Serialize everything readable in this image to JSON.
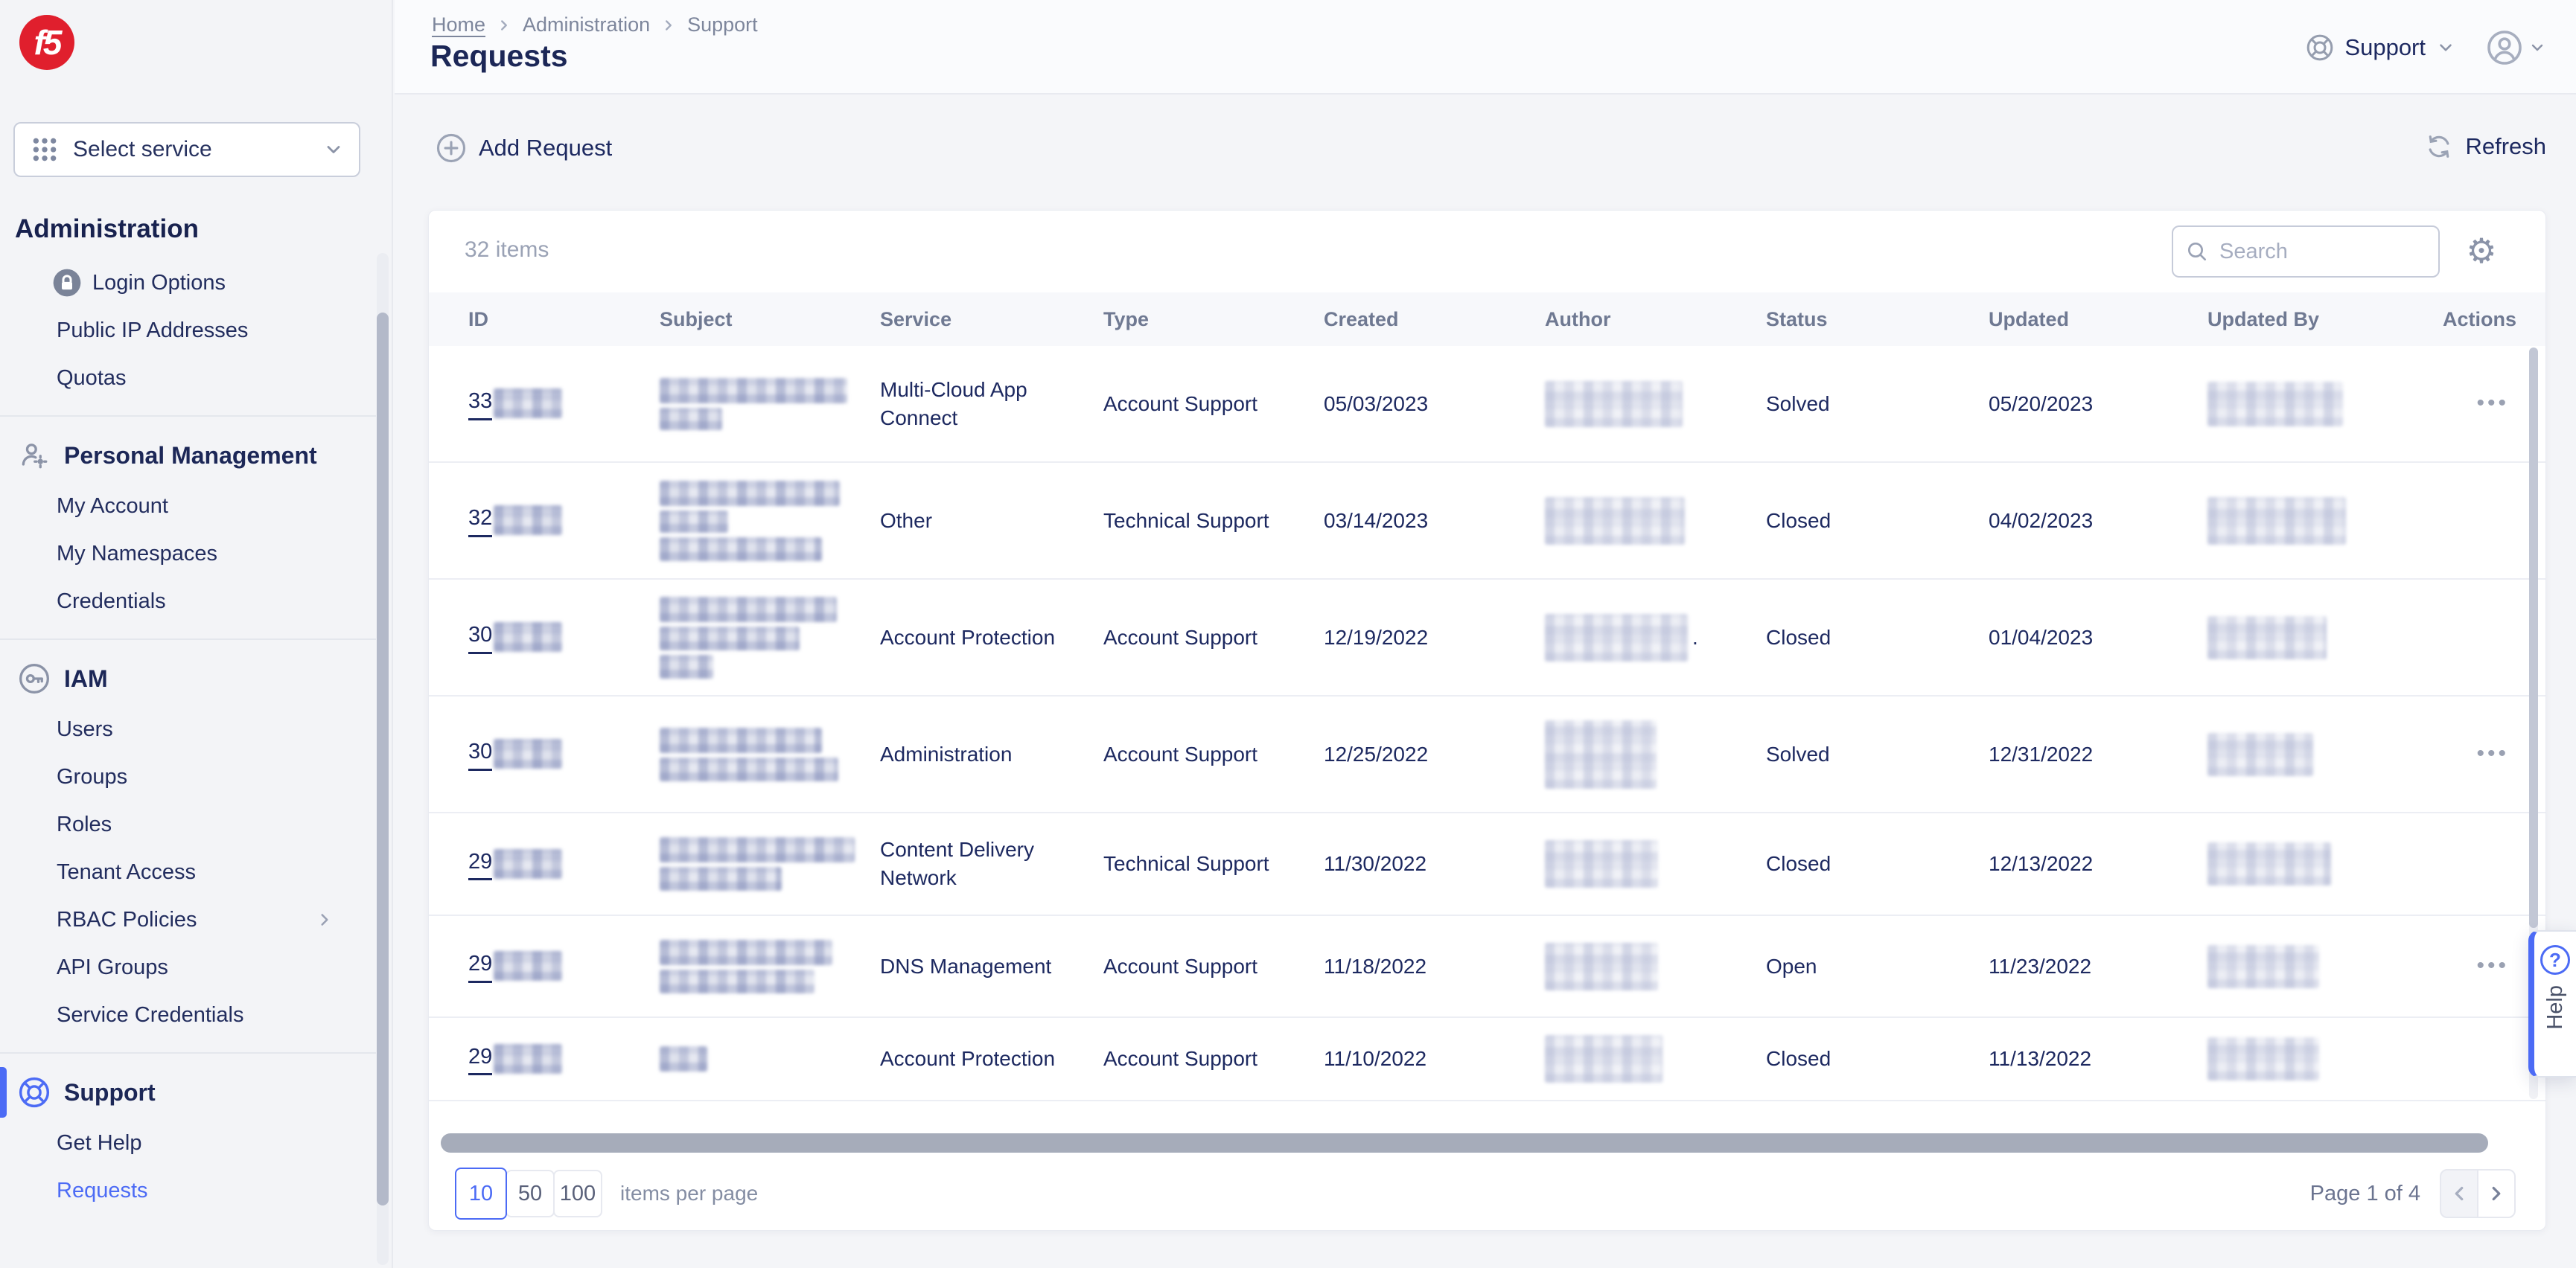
{
  "brand": {
    "logo_text": "f5"
  },
  "sidebar": {
    "select_service": "Select service",
    "admin_header": "Administration",
    "items_admin": [
      "Login Options",
      "Public IP Addresses",
      "Quotas"
    ],
    "personal_header": "Personal Management",
    "items_personal": [
      "My Account",
      "My Namespaces",
      "Credentials"
    ],
    "iam_header": "IAM",
    "items_iam": [
      "Users",
      "Groups",
      "Roles",
      "Tenant Access",
      "RBAC Policies",
      "API Groups",
      "Service Credentials"
    ],
    "support_header": "Support",
    "items_support": [
      "Get Help",
      "Requests"
    ],
    "active_item": "Requests"
  },
  "breadcrumb": {
    "items": [
      "Home",
      "Administration",
      "Support"
    ]
  },
  "page_title": "Requests",
  "topbar": {
    "support_label": "Support"
  },
  "toolbar": {
    "add_request": "Add Request",
    "refresh": "Refresh"
  },
  "main": {
    "table": {
      "summary": "32 items",
      "search_placeholder": "Search",
      "columns": [
        "ID",
        "Subject",
        "Service",
        "Type",
        "Created",
        "Author",
        "Status",
        "Updated",
        "Updated By",
        "Actions"
      ],
      "rows": [
        {
          "id": "33",
          "service": "Multi-Cloud App Connect",
          "type": "Account Support",
          "created": "05/03/2023",
          "status": "Solved",
          "updated": "05/20/2023",
          "actions": "•••",
          "author_note": ""
        },
        {
          "id": "32",
          "service": "Other",
          "type": "Technical Support",
          "created": "03/14/2023",
          "status": "Closed",
          "updated": "04/02/2023",
          "actions": "",
          "author_note": ""
        },
        {
          "id": "30",
          "service": "Account Protection",
          "type": "Account Support",
          "created": "12/19/2022",
          "status": "Closed",
          "updated": "01/04/2023",
          "actions": "",
          "author_note": "."
        },
        {
          "id": "30",
          "service": "Administration",
          "type": "Account Support",
          "created": "12/25/2022",
          "status": "Solved",
          "updated": "12/31/2022",
          "actions": "•••",
          "author_note": ""
        },
        {
          "id": "29",
          "service": "Content Delivery Network",
          "type": "Technical Support",
          "created": "11/30/2022",
          "status": "Closed",
          "updated": "12/13/2022",
          "actions": "",
          "author_note": ""
        },
        {
          "id": "29",
          "service": "DNS Management",
          "type": "Account Support",
          "created": "11/18/2022",
          "status": "Open",
          "updated": "11/23/2022",
          "actions": "•••",
          "author_note": ""
        },
        {
          "id": "29",
          "service": "Account Protection",
          "type": "Account Support",
          "created": "11/10/2022",
          "status": "Closed",
          "updated": "11/13/2022",
          "actions": "",
          "author_note": ""
        }
      ]
    },
    "pagination": {
      "sizes": [
        "10",
        "50",
        "100"
      ],
      "selected_size": "10",
      "label": "items per page",
      "page_info": "Page 1 of 4"
    }
  },
  "help": {
    "label": "Help",
    "question_mark": "?"
  }
}
